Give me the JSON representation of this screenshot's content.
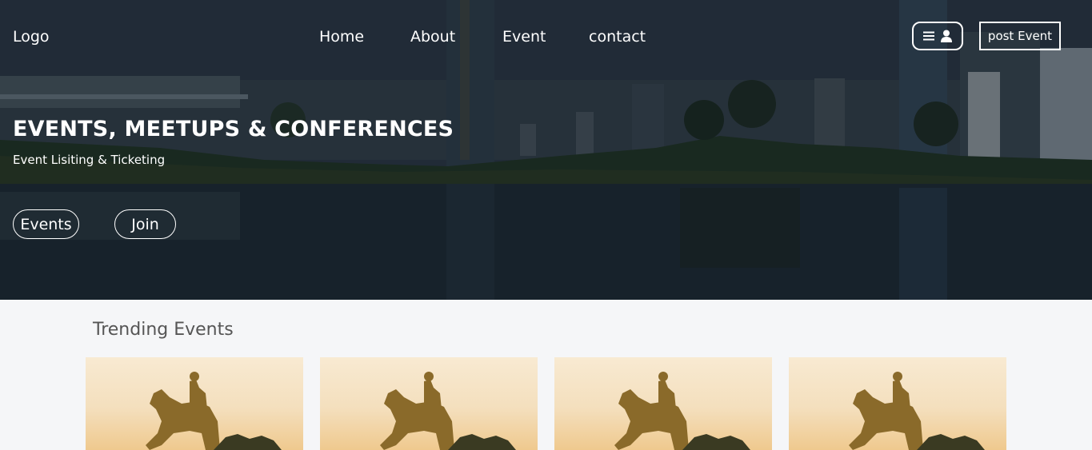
{
  "header": {
    "logo": "Logo",
    "nav": [
      "Home",
      "About",
      "Event",
      "contact"
    ],
    "post_button": "post Event",
    "user_menu_icons": [
      "menu-icon",
      "user-icon"
    ]
  },
  "hero": {
    "title": "EVENTS, MEETUPS & CONFERENCES",
    "subtitle": "Event Lisiting & Ticketing",
    "buttons": [
      "Events",
      "Join"
    ]
  },
  "trending": {
    "title": "Trending Events",
    "cards": [
      {
        "image": "equestrian-statue-photo"
      },
      {
        "image": "equestrian-statue-photo"
      },
      {
        "image": "equestrian-statue-photo"
      },
      {
        "image": "equestrian-statue-photo"
      }
    ]
  }
}
